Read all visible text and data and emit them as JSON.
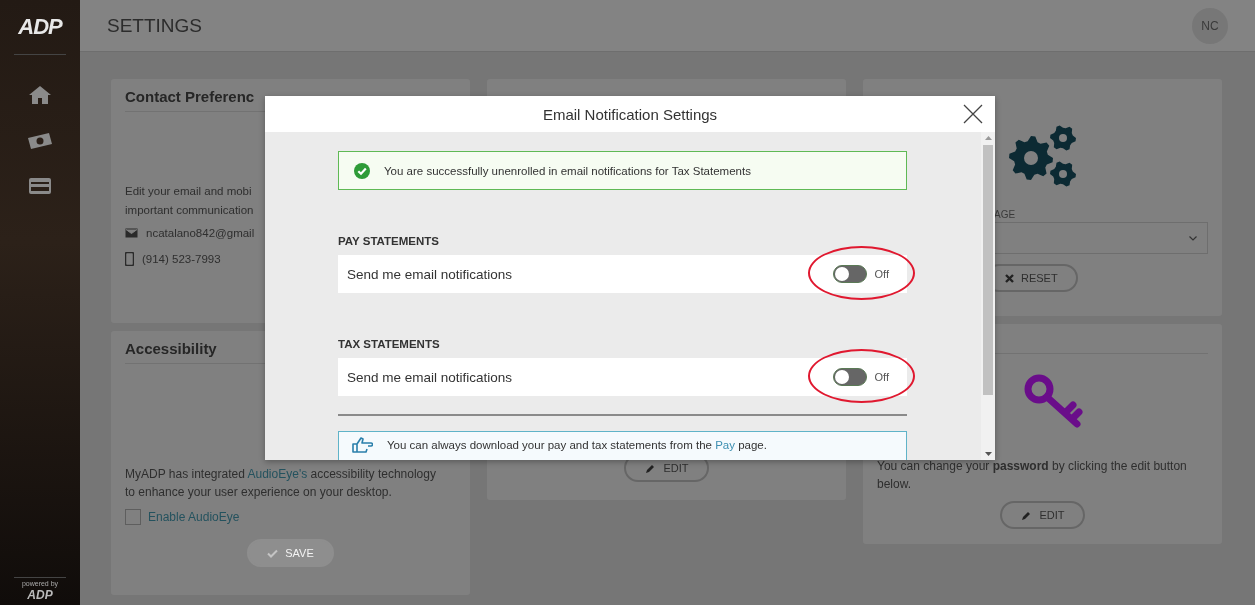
{
  "sidebar": {
    "logo": "ADP",
    "footer_caption": "powered by",
    "footer_logo": "ADP"
  },
  "header": {
    "title": "SETTINGS",
    "avatar": "NC"
  },
  "contact_card": {
    "title": "Contact Preferenc",
    "description_lines": [
      "Edit your email and mobi",
      "important communication"
    ],
    "email": "ncatalano842@gmail",
    "phone": "(914) 523-7993"
  },
  "accessibility_card": {
    "title": "Accessibility",
    "text_before": "MyADP has integrated ",
    "link": "AudioEye's",
    "text_after": " accessibility technology to enhance your user experience on your desktop.",
    "checkbox": {
      "label": "Enable AudioEye",
      "checked": false
    },
    "save_button": {
      "label": "SAVE",
      "disabled": true
    }
  },
  "email_card": {
    "edit_button": "EDIT"
  },
  "landing_card": {
    "field_label": "AGE",
    "reset_button": "RESET"
  },
  "password_card": {
    "text": "You can change your **password** by clicking the edit button below.",
    "edit_button": "EDIT"
  },
  "modal": {
    "title": "Email Notification Settings",
    "alert": "You are successfully unenrolled in email notifications for Tax Statements",
    "sections": [
      {
        "heading": "PAY STATEMENTS",
        "label": "Send me email notifications",
        "on": false,
        "state_label": "Off",
        "highlighted": true
      },
      {
        "heading": "TAX STATEMENTS",
        "label": "Send me email notifications",
        "on": false,
        "state_label": "Off",
        "highlighted": true
      }
    ],
    "info": {
      "text_before": "You can always download your pay and tax statements from the ",
      "link": "Pay",
      "text_after": " page."
    }
  }
}
